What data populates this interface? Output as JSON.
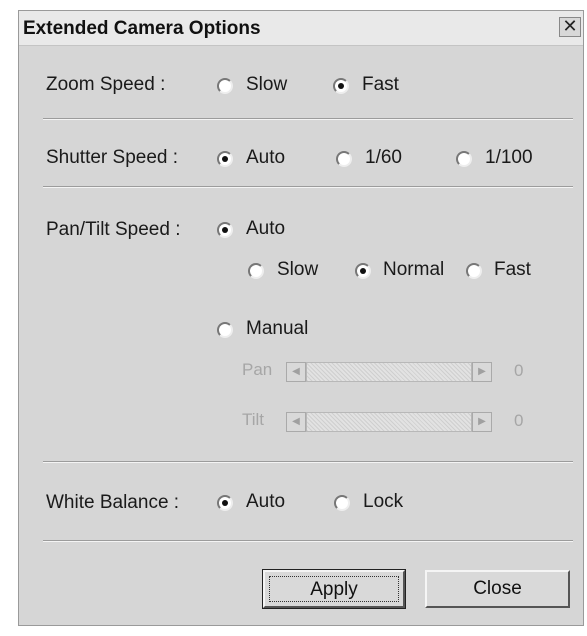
{
  "window": {
    "title": "Extended Camera Options",
    "close_glyph": "✕"
  },
  "zoom": {
    "label": "Zoom Speed :",
    "options": [
      "Slow",
      "Fast"
    ],
    "selected": "Fast"
  },
  "shutter": {
    "label": "Shutter Speed :",
    "options": [
      "Auto",
      "1/60",
      "1/100"
    ],
    "selected": "Auto"
  },
  "pantilt": {
    "label": "Pan/Tilt Speed :",
    "auto_label": "Auto",
    "speed_options": [
      "Slow",
      "Normal",
      "Fast"
    ],
    "speed_selected": "Normal",
    "manual_label": "Manual",
    "mode_selected": "Auto",
    "pan": {
      "label": "Pan",
      "value": "0"
    },
    "tilt": {
      "label": "Tilt",
      "value": "0"
    }
  },
  "white_balance": {
    "label": "White Balance :",
    "options": [
      "Auto",
      "Lock"
    ],
    "selected": "Auto"
  },
  "buttons": {
    "apply": "Apply",
    "close": "Close"
  },
  "icons": {
    "arrow_left": "◀",
    "arrow_right": "▶"
  }
}
